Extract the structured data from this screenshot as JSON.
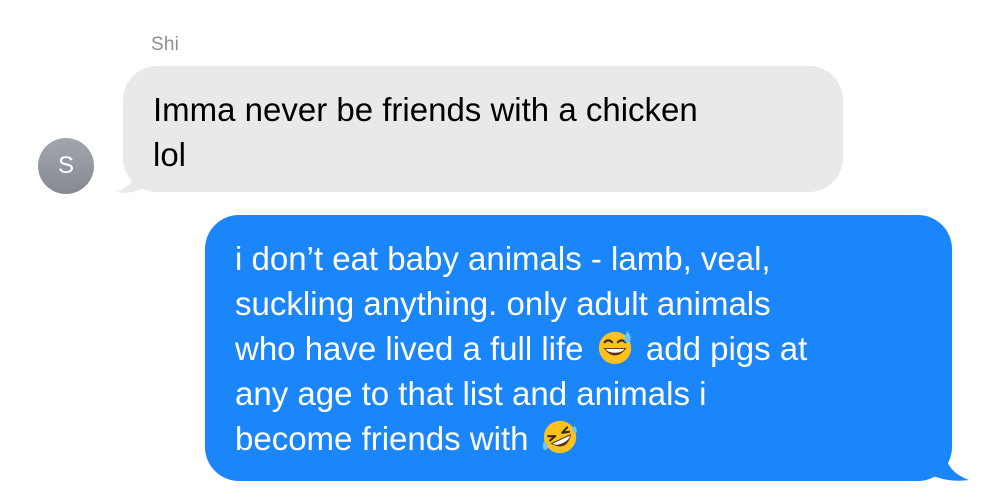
{
  "conversation": {
    "sender_name": "Shi",
    "avatar_initial": "S",
    "incoming_message": {
      "lines": [
        "Imma never be friends with a chicken",
        "lol"
      ]
    },
    "outgoing_message": {
      "line1": "i don’t eat baby animals - lamb, veal,",
      "line2": "suckling anything. only adult animals",
      "line3_before": "who have lived a full life",
      "line3_emoji": "grinning-face-with-sweat-icon",
      "line3_after": "add pigs at",
      "line4": "any age to that list and animals i",
      "line5_before": "become friends with",
      "line5_emoji": "rolling-on-floor-laughing-icon"
    }
  },
  "colors": {
    "incoming_bubble": "#e9e9eb",
    "outgoing_bubble": "#1b86f9",
    "sender_name": "#8e8e93",
    "avatar": "#8e9198"
  }
}
